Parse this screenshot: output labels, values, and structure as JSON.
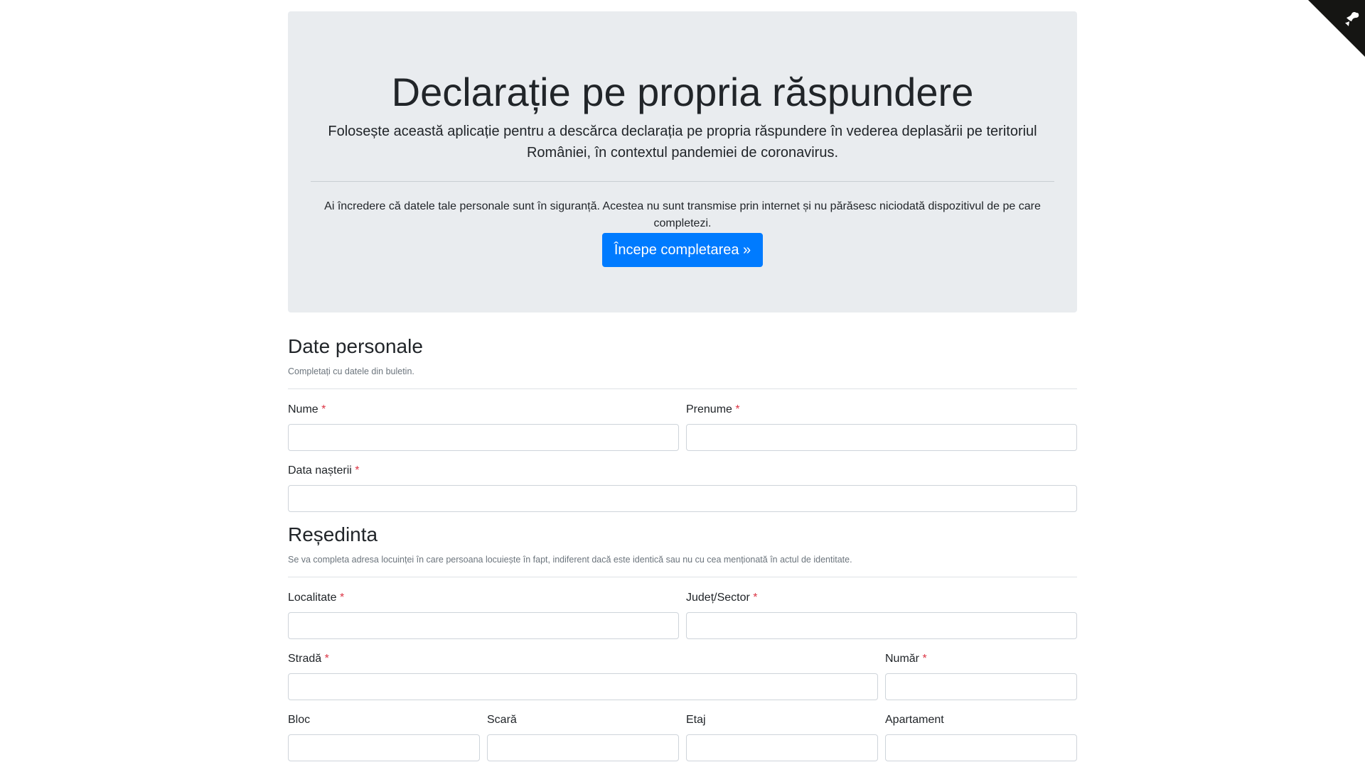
{
  "header": {
    "title": "Declarație pe propria răspundere",
    "lead": "Folosește această aplicație pentru a descărca declarația pe propria răspundere în vederea deplasării pe teritoriul României, în contextul pandemiei de coronavirus.",
    "trust": "Ai încredere că datele tale personale sunt în siguranță. Acestea nu sunt transmise prin internet și nu părăsesc niciodată dispozitivul de pe care completezi.",
    "start_button": "Începe completarea »"
  },
  "personal": {
    "title": "Date personale",
    "subtitle": "Completați cu datele din buletin.",
    "fields": {
      "nume": {
        "label": "Nume",
        "value": ""
      },
      "prenume": {
        "label": "Prenume",
        "value": ""
      },
      "data_nasterii": {
        "label": "Data nașterii",
        "value": ""
      }
    }
  },
  "residence": {
    "title": "Reședinta",
    "subtitle": "Se va completa adresa locuinței în care persoana locuiește în fapt, indiferent dacă este identică sau nu cu cea menționată în actul de identitate.",
    "fields": {
      "localitate": {
        "label": "Localitate",
        "value": ""
      },
      "judet": {
        "label": "Județ/Sector",
        "value": ""
      },
      "strada": {
        "label": "Stradă",
        "value": ""
      },
      "numar": {
        "label": "Număr",
        "value": ""
      },
      "bloc": {
        "label": "Bloc",
        "value": ""
      },
      "scara": {
        "label": "Scară",
        "value": ""
      },
      "etaj": {
        "label": "Etaj",
        "value": ""
      },
      "apartament": {
        "label": "Apartament",
        "value": ""
      }
    }
  },
  "required_marker": "*",
  "colors": {
    "primary": "#007bff",
    "jumbotron": "#e9ecef",
    "required": "#dc3545"
  },
  "icons": {
    "corner": "github-octocat-icon"
  }
}
